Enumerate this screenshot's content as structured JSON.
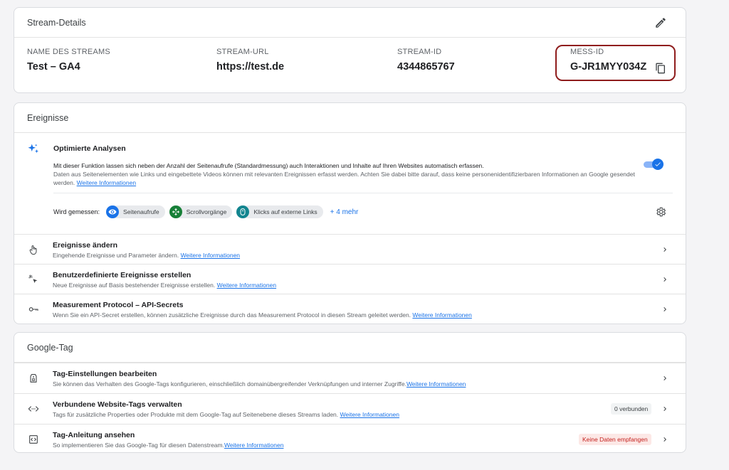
{
  "stream_details": {
    "title": "Stream-Details",
    "name_label": "NAME DES STREAMS",
    "name_value": "Test  – GA4",
    "url_label": "STREAM-URL",
    "url_value": "https://test.de",
    "id_label": "STREAM-ID",
    "id_value": "4344865767",
    "mess_label": "MESS-ID",
    "mess_value": "G-JR1MYY034Z",
    "highlight_color": "#8f1d1d"
  },
  "events": {
    "title": "Ereignisse",
    "enhanced": {
      "title": "Optimierte Analysen",
      "desc1": "Mit dieser Funktion lassen sich neben der Anzahl der Seitenaufrufe (Standardmessung) auch Interaktionen und Inhalte auf Ihren Websites automatisch erfassen.",
      "desc2": "Daten aus Seitenelementen wie Links und eingebettete Videos können mit relevanten Ereignissen erfasst werden. Achten Sie dabei bitte darauf, dass keine personenidentifizierbaren Informationen an Google gesendet werden.",
      "link": "Weitere Informationen",
      "toggle_on": true,
      "measured_label": "Wird gemessen:",
      "chips": [
        {
          "label": "Seitenaufrufe",
          "icon": "eye-icon",
          "color": "#1a73e8"
        },
        {
          "label": "Scrollvorgänge",
          "icon": "scroll-icon",
          "color": "#188038"
        },
        {
          "label": "Klicks auf externe Links",
          "icon": "mouse-icon",
          "color": "#12858f"
        }
      ],
      "more": "+ 4 mehr"
    },
    "rows": [
      {
        "title": "Ereignisse ändern",
        "desc": "Eingehende Ereignisse und Parameter ändern. ",
        "link": "Weitere Informationen",
        "icon": "touch-icon"
      },
      {
        "title": "Benutzerdefinierte Ereignisse erstellen",
        "desc": "Neue Ereignisse auf Basis bestehender Ereignisse erstellen. ",
        "link": "Weitere Informationen",
        "icon": "sparkle-cursor-icon"
      },
      {
        "title": "Measurement Protocol – API-Secrets",
        "desc": "Wenn Sie ein API-Secret erstellen, können zusätzliche Ereignisse durch das Measurement Protocol in diesen Stream geleitet werden. ",
        "link": "Weitere Informationen",
        "icon": "key-icon"
      }
    ]
  },
  "google_tag": {
    "title": "Google-Tag",
    "rows": [
      {
        "title": "Tag-Einstellungen bearbeiten",
        "desc": "Sie können das Verhalten des Google-Tags konfigurieren, einschließlich domainübergreifender Verknüpfungen und interner Zugriffe.",
        "link": "Weitere Informationen",
        "icon": "tag-icon"
      },
      {
        "title": "Verbundene Website-Tags verwalten",
        "desc": "Tags für zusätzliche Properties oder Produkte mit dem Google-Tag auf Seitenebene dieses Streams laden. ",
        "link": "Weitere Informationen",
        "icon": "code-arrows-icon",
        "badge": "0 verbunden"
      },
      {
        "title": "Tag-Anleitung ansehen",
        "desc": "So implementieren Sie das Google-Tag für diesen Datenstream.",
        "link": "Weitere Informationen",
        "icon": "code-box-icon",
        "badge": "Keine Daten empfangen"
      }
    ]
  },
  "colors": {
    "accent": "#1a73e8",
    "warn_bg": "#fce8e6",
    "warn_text": "#c5221f",
    "neutral_badge_bg": "#f1f3f4"
  }
}
